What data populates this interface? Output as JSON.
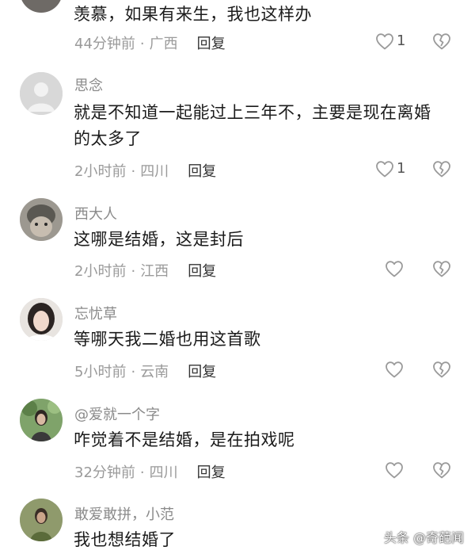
{
  "comments": [
    {
      "text": "羡慕，如果有来生，我也这样办",
      "time": "44分钟前",
      "location": "广西",
      "reply": "回复",
      "likes": "1"
    },
    {
      "username": "思念",
      "text_line1": "就是不知道一起能过上三年不，主要是现在离婚",
      "text_line2": "的太多了",
      "time": "2小时前",
      "location": "四川",
      "reply": "回复",
      "likes": "1"
    },
    {
      "username": "西大人",
      "text": "这哪是结婚，这是封后",
      "time": "2小时前",
      "location": "江西",
      "reply": "回复"
    },
    {
      "username": "忘忧草",
      "text": "等哪天我二婚也用这首歌",
      "time": "5小时前",
      "location": "云南",
      "reply": "回复"
    },
    {
      "username": "@爱就一个字",
      "text": "咋觉着不是结婚，是在拍戏呢",
      "time": "32分钟前",
      "location": "四川",
      "reply": "回复"
    },
    {
      "username": "敢爱敢拼，小范",
      "text": "我也想结婚了"
    }
  ],
  "separator": "·",
  "watermark": "头条 @奇葩闻",
  "icons": {
    "like": "heart-outline-icon",
    "dislike": "broken-heart-icon",
    "default_avatar": "person-silhouette-icon"
  }
}
